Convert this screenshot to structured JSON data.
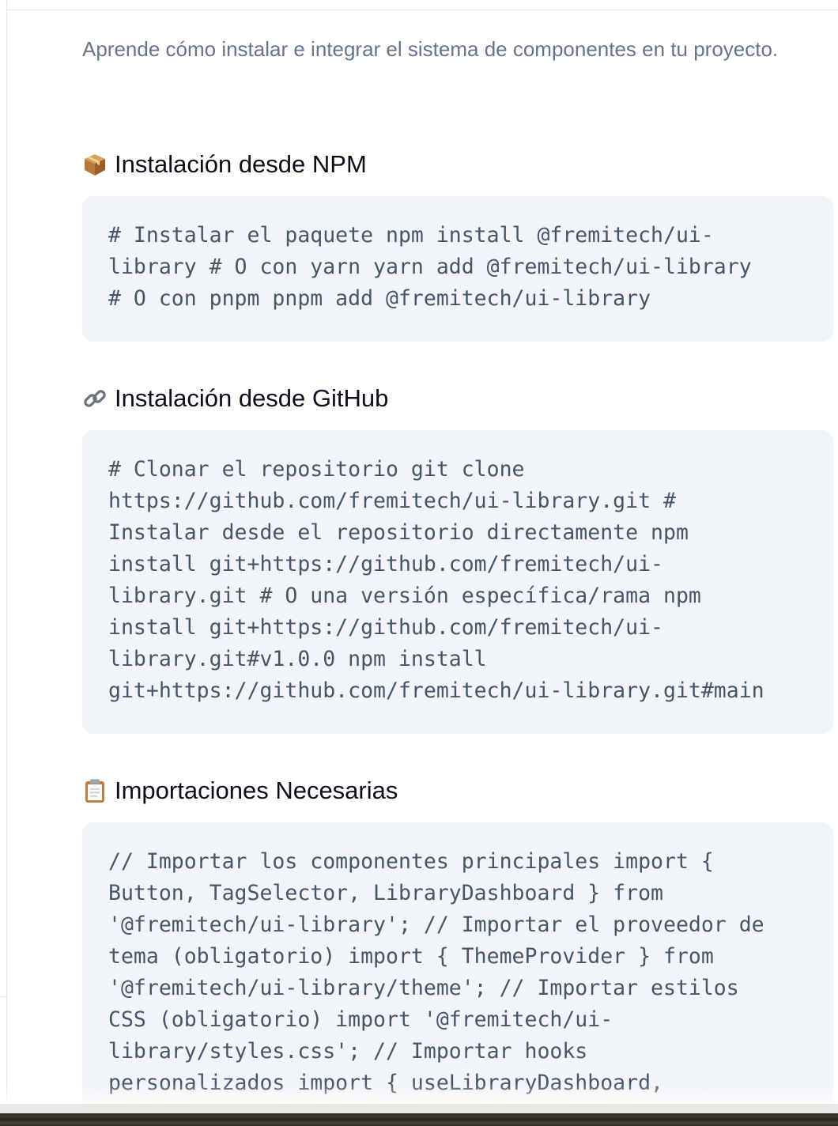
{
  "page": {
    "intro": "Aprende cómo instalar e integrar el sistema de componentes en tu proyecto."
  },
  "sections": [
    {
      "icon": "package-icon",
      "title": "Instalación desde NPM",
      "code": "# Instalar el paquete npm install @fremitech/ui-\nlibrary # O con yarn yarn add @fremitech/ui-library\n# O con pnpm pnpm add @fremitech/ui-library"
    },
    {
      "icon": "link-icon",
      "title": "Instalación desde GitHub",
      "code": "# Clonar el repositorio git clone\nhttps://github.com/fremitech/ui-library.git #\nInstalar desde el repositorio directamente npm\ninstall git+https://github.com/fremitech/ui-\nlibrary.git # O una versión específica/rama npm\ninstall git+https://github.com/fremitech/ui-\nlibrary.git#v1.0.0 npm install\ngit+https://github.com/fremitech/ui-library.git#main"
    },
    {
      "icon": "clipboard-icon",
      "title": "Importaciones Necesarias",
      "code": "// Importar los componentes principales import {\nButton, TagSelector, LibraryDashboard } from\n'@fremitech/ui-library'; // Importar el proveedor de\ntema (obligatorio) import { ThemeProvider } from\n'@fremitech/ui-library/theme'; // Importar estilos\nCSS (obligatorio) import '@fremitech/ui-\nlibrary/styles.css'; // Importar hooks\npersonalizados import { useLibraryDashboard,"
    }
  ]
}
